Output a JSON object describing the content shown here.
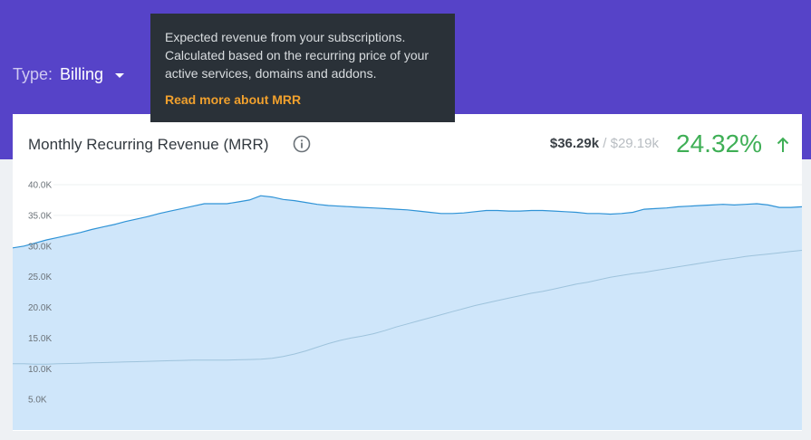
{
  "header": {
    "type_label": "Type:",
    "type_value": "Billing"
  },
  "tooltip": {
    "text": "Expected revenue from your subscriptions. Calculated based on the recurring price of your active services, domains and addons.",
    "link_text": "Read more about MRR"
  },
  "card": {
    "title": "Monthly Recurring Revenue (MRR)",
    "current_total": "$36.29k",
    "separator": "/",
    "previous_total": "$29.19k",
    "change_percent": "24.32%"
  },
  "colors": {
    "header_bg": "#5643c8",
    "area_fill": "#cfe6fa",
    "current_line": "#2f93d6",
    "previous_line": "#9ec3dc",
    "positive": "#3faf56",
    "tooltip_bg": "#2a3138",
    "tooltip_link": "#f0a02d"
  },
  "chart_data": {
    "type": "area",
    "ylim": [
      0,
      40000
    ],
    "y_ticks": [
      "5.0K",
      "10.0K",
      "15.0K",
      "20.0K",
      "25.0K",
      "30.0K",
      "35.0K",
      "40.0K"
    ],
    "y_tick_values": [
      5000,
      10000,
      15000,
      20000,
      25000,
      30000,
      35000,
      40000
    ],
    "series": [
      {
        "values": [
          29700,
          30000,
          30500,
          31000,
          31400,
          31800,
          32200,
          32700,
          33100,
          33500,
          34000,
          34400,
          34800,
          35300,
          35700,
          36100,
          36500,
          36900,
          36900,
          36900,
          37200,
          37500,
          38200,
          38000,
          37600,
          37400,
          37100,
          36800,
          36600,
          36500,
          36400,
          36300,
          36200,
          36100,
          36000,
          35900,
          35700,
          35500,
          35300,
          35300,
          35400,
          35600,
          35800,
          35800,
          35700,
          35700,
          35800,
          35800,
          35700,
          35600,
          35500,
          35300,
          35300,
          35200,
          35300,
          35500,
          36000,
          36100,
          36200,
          36400,
          36500,
          36600,
          36700,
          36800,
          36700,
          36800,
          36900,
          36700,
          36300,
          36300,
          36400
        ]
      },
      {
        "values": [
          10800,
          10800,
          10750,
          10750,
          10800,
          10850,
          10900,
          10950,
          11000,
          11050,
          11100,
          11150,
          11200,
          11250,
          11300,
          11350,
          11400,
          11400,
          11400,
          11400,
          11450,
          11500,
          11550,
          11700,
          12000,
          12400,
          12900,
          13500,
          14100,
          14600,
          15000,
          15300,
          15700,
          16200,
          16800,
          17300,
          17800,
          18300,
          18800,
          19300,
          19800,
          20300,
          20700,
          21100,
          21500,
          21900,
          22300,
          22600,
          23000,
          23400,
          23800,
          24100,
          24500,
          24900,
          25200,
          25500,
          25700,
          26000,
          26300,
          26600,
          26900,
          27200,
          27500,
          27800,
          28000,
          28300,
          28500,
          28700,
          28900,
          29100,
          29300
        ]
      }
    ]
  }
}
